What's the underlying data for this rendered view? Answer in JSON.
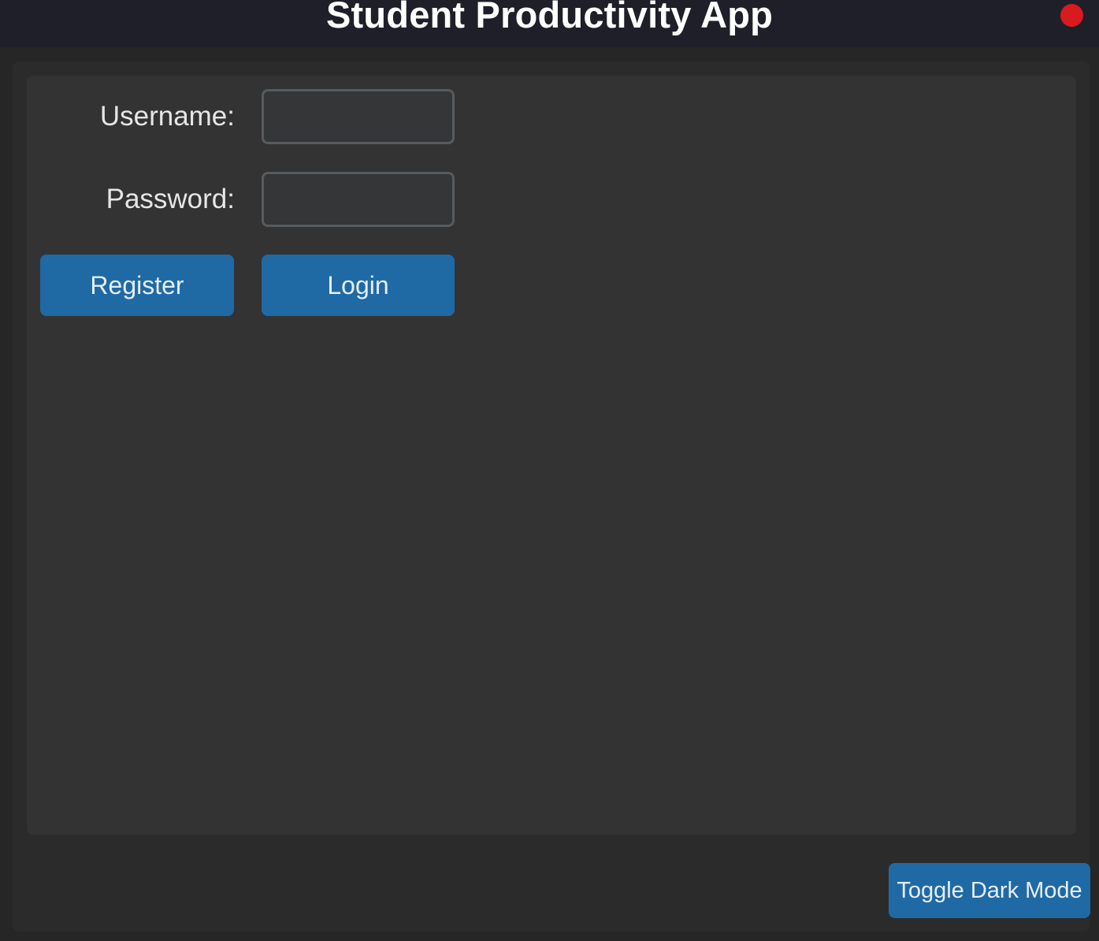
{
  "window": {
    "title": "Student Productivity App",
    "close_color": "#d91a1f"
  },
  "form": {
    "username_label": "Username:",
    "username_value": "",
    "password_label": "Password:",
    "password_value": ""
  },
  "actions": {
    "register_label": "Register",
    "login_label": "Login"
  },
  "footer": {
    "toggle_label": "Toggle Dark Mode"
  },
  "colors": {
    "accent": "#1f6aa5",
    "titlebar": "#1f1f29",
    "panel": "#333333"
  }
}
